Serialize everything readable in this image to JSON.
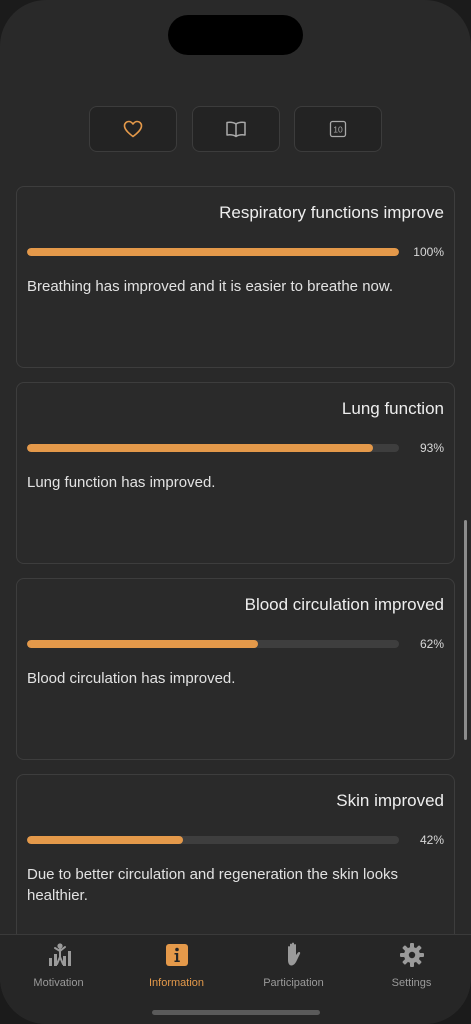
{
  "segments": [
    {
      "icon": "heart-icon",
      "active": true
    },
    {
      "icon": "book-icon",
      "active": false
    },
    {
      "icon": "calendar-10-icon",
      "label": "10",
      "active": false
    }
  ],
  "cards": [
    {
      "title": "Respiratory functions improve",
      "progress": 1.0,
      "percent_label": "100%",
      "text": "Breathing has improved and it is easier to breathe now."
    },
    {
      "title": "Lung function",
      "progress": 0.93,
      "percent_label": "93%",
      "text": "Lung function has improved."
    },
    {
      "title": "Blood circulation improved",
      "progress": 0.62,
      "percent_label": "62%",
      "text": "Blood circulation has improved."
    },
    {
      "title": "Skin improved",
      "progress": 0.42,
      "percent_label": "42%",
      "text": "Due to better circulation and regeneration the skin looks healthier."
    }
  ],
  "tabbar": {
    "items": [
      {
        "label": "Motivation",
        "icon": "motivation-chart-icon",
        "active": false
      },
      {
        "label": "Information",
        "icon": "info-icon",
        "active": true
      },
      {
        "label": "Participation",
        "icon": "hand-icon",
        "active": false
      },
      {
        "label": "Settings",
        "icon": "gear-icon",
        "active": false
      }
    ]
  },
  "colors": {
    "accent": "#e4994a",
    "background": "#292929",
    "card_border": "#3d3d3d"
  }
}
